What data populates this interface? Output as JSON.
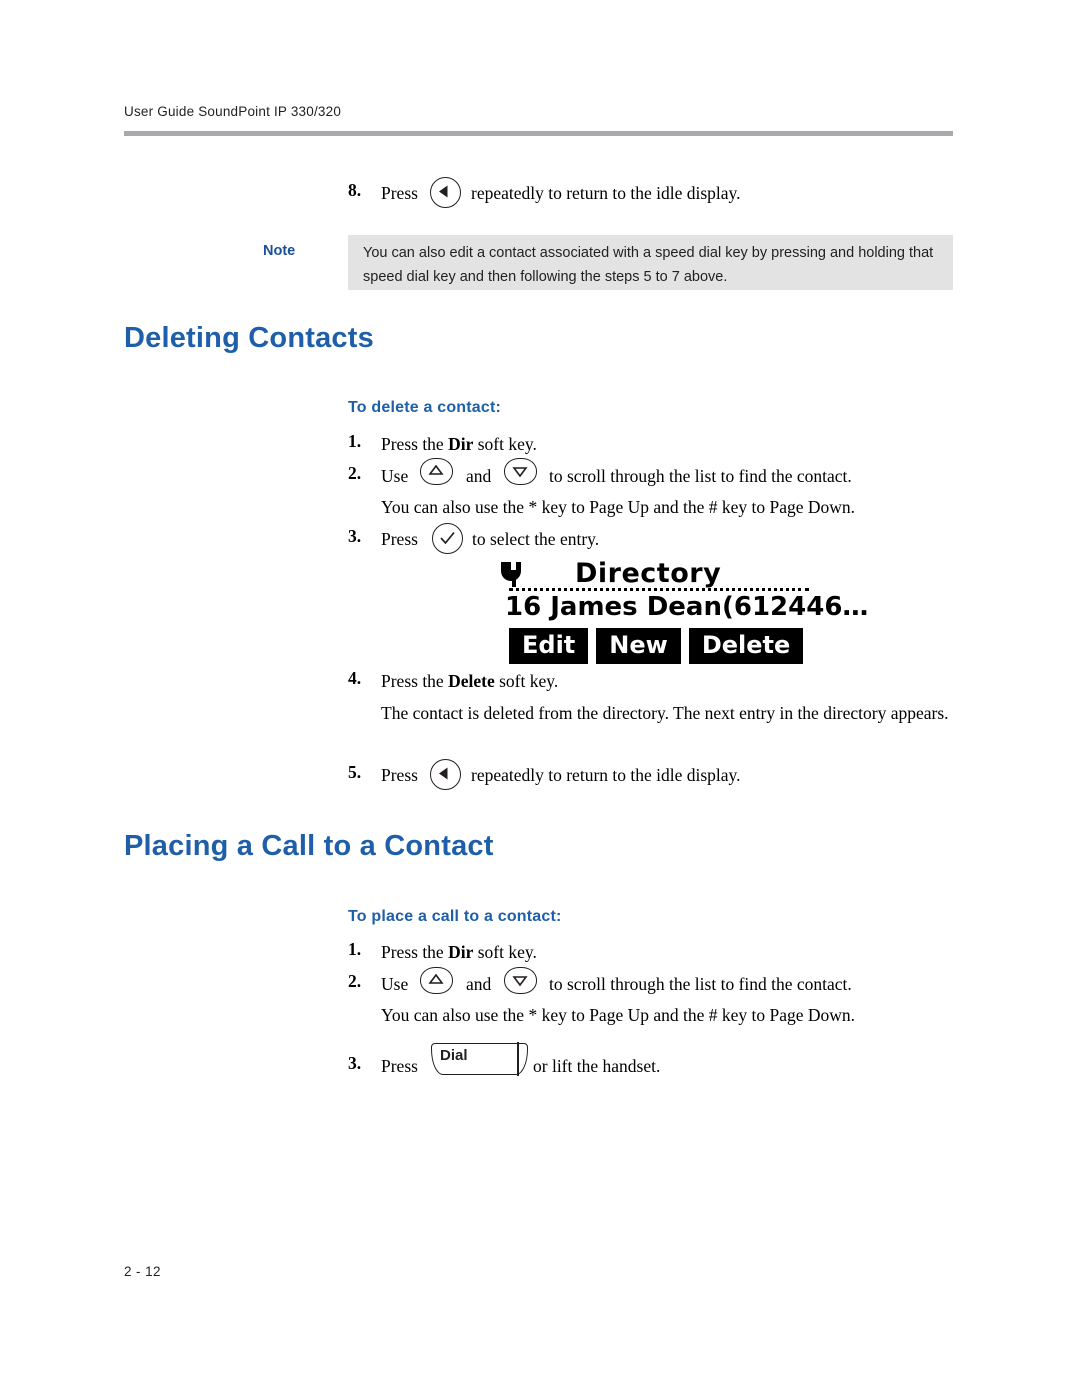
{
  "header": {
    "running_head": "User Guide SoundPoint IP 330/320"
  },
  "footer": {
    "page_number": "2 - 12"
  },
  "step8": {
    "number": "8.",
    "before_icon": "Press",
    "icon": "left-arrow-key-icon",
    "after_icon": "repeatedly to return to the idle display."
  },
  "note": {
    "label": "Note",
    "text": "You can also edit a contact associated with a speed dial key by pressing and holding that speed dial key and then following the steps 5 to 7 above."
  },
  "section_delete": {
    "heading": "Deleting Contacts",
    "subheading": "To delete a contact:",
    "steps": {
      "one_num": "1.",
      "one_pre": "Press the ",
      "one_bold": "Dir",
      "one_post": " soft key.",
      "two_num": "2.",
      "two_pre": "Use",
      "two_mid": "and",
      "two_post": "to scroll through the list to find the contact.",
      "two_sub": "You can also use the * key to Page Up and the # key to Page Down.",
      "three_num": "3.",
      "three_pre": "Press",
      "three_post": "to select the entry.",
      "four_num": "4.",
      "four_pre": "Press the ",
      "four_bold": "Delete",
      "four_post": " soft key.",
      "four_sub": "The contact is deleted from the directory. The next entry in the directory appears.",
      "five_num": "5.",
      "five_pre": "Press",
      "five_post": "repeatedly to return to the idle display."
    },
    "lcd": {
      "title": "Directory",
      "entry": "16 James Dean(612446…",
      "softkeys": [
        "Edit",
        "New",
        "Delete"
      ]
    }
  },
  "section_place": {
    "heading": "Placing a Call to a Contact",
    "subheading": "To place a call to a contact:",
    "steps": {
      "one_num": "1.",
      "one_pre": "Press the ",
      "one_bold": "Dir",
      "one_post": " soft key.",
      "two_num": "2.",
      "two_pre": "Use",
      "two_mid": "and",
      "two_post": "to scroll through the list to find the contact.",
      "two_sub": "You can also use the * key to Page Up and the # key to Page Down.",
      "three_num": "3.",
      "three_pre": "Press",
      "three_post": "or lift the handset.",
      "dial_label": "Dial"
    }
  },
  "colors": {
    "heading_blue": "#1f5fa9",
    "note_bg": "#e3e3e3",
    "rule_gray": "#a7a9ac"
  }
}
